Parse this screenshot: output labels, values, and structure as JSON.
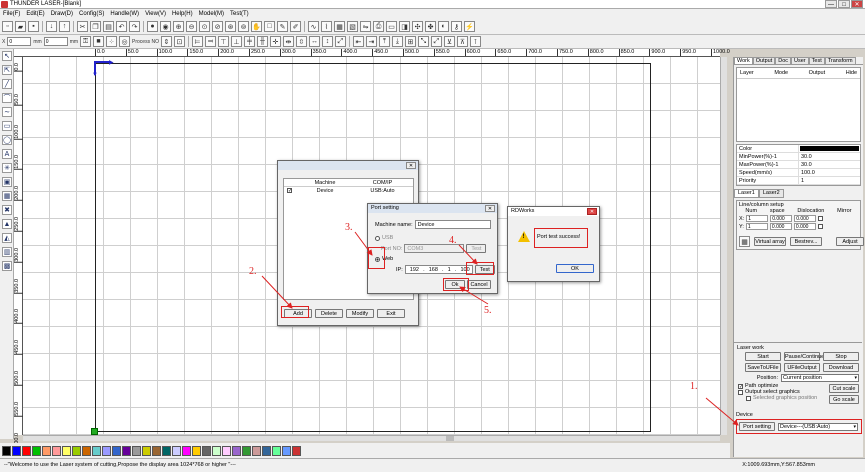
{
  "window": {
    "title": "THUNDER LASER-[Blank]",
    "minimize": "—",
    "maximize": "□",
    "close": "✕"
  },
  "menu": [
    "File(F)",
    "Edit(E)",
    "Draw(D)",
    "Config(S)",
    "Handle(W)",
    "View(V)",
    "Help(H)",
    "Model(M)",
    "Test(T)"
  ],
  "toolbar2": {
    "x_unit": "mm",
    "y_unit": "mm",
    "x_val": "0",
    "y_val": "0",
    "process_no": "Process NO"
  },
  "ruler_h": [
    "0.0",
    "50.0",
    "100.0",
    "150.0",
    "200.0",
    "250.0",
    "300.0",
    "350.0",
    "400.0",
    "450.0",
    "500.0",
    "550.0",
    "600.0",
    "650.0",
    "700.0",
    "750.0",
    "800.0",
    "850.0",
    "900.0",
    "950.0",
    "1000.0"
  ],
  "ruler_v": [
    "0.0",
    "50.0",
    "100.0",
    "150.0",
    "200.0",
    "250.0",
    "300.0",
    "350.0",
    "400.0",
    "450.0",
    "500.0",
    "550.0",
    "600.0"
  ],
  "right_panel": {
    "tabs": [
      "Work",
      "Output",
      "Doc",
      "User",
      "Test",
      "Transform"
    ],
    "layer_cols": [
      "Layer",
      "Mode",
      "Output",
      "Hide"
    ],
    "props": [
      {
        "k": "Color",
        "v": ""
      },
      {
        "k": "MinPower(%)-1",
        "v": "30.0"
      },
      {
        "k": "MaxPower(%)-1",
        "v": "30.0"
      },
      {
        "k": "Speed(mm/s)",
        "v": "100.0"
      },
      {
        "k": "Priority",
        "v": "1"
      }
    ],
    "subtabs": [
      "Laser1",
      "Laser2"
    ],
    "lc_title": "Line/column setup",
    "lc_cols": [
      "Num",
      "space",
      "Dislocation",
      "Mirror"
    ],
    "lc_x": {
      "label": "X:",
      "num": "1",
      "space": "0.000",
      "disloc": "0.000"
    },
    "lc_y": {
      "label": "Y:",
      "num": "1",
      "space": "0.000",
      "disloc": "0.000"
    },
    "lc_buttons": [
      "Virtual array",
      "Bestrev...",
      "Adjust"
    ],
    "lc_selected": "Selected graphics position"
  },
  "laser_work": {
    "title": "Laser work",
    "row1": [
      "Start",
      "Pause/Continue",
      "Stop"
    ],
    "row2": [
      "SaveToUFile",
      "UFileOutput",
      "Download"
    ],
    "position_label": "Position:",
    "position_value": "Current position",
    "path_optimize": "Path optimize",
    "output_select": "Output select graphics",
    "selected_pos": "Selected graphics position",
    "cut_scale": "Cut scale",
    "go_scale": "Go scale",
    "device_label": "Device",
    "port_setting": "Port setting",
    "device_value": "Device---(USB:Auto)"
  },
  "dialog_device": {
    "close": "✕",
    "cols": [
      "Machine",
      "COM/IP"
    ],
    "row": {
      "machine": "Device",
      "port": "USB:Auto"
    },
    "buttons": [
      "Add",
      "Delete",
      "Modify",
      "Exit"
    ]
  },
  "dialog_port": {
    "title": "Port setting",
    "close": "✕",
    "machine_label": "Machine name:",
    "machine_value": "Device",
    "usb_label": "USB",
    "port_no_label": "Port NO:",
    "port_no_value": "COM3",
    "test_disabled": "Test",
    "web_label": "Web",
    "ip_label": "IP:",
    "ip": [
      "192",
      "168",
      "1",
      "100"
    ],
    "test": "Test",
    "ok": "Ok",
    "cancel": "Cancel"
  },
  "dialog_msg": {
    "title": "RDWorks",
    "close": "✕",
    "message": "Port test success!",
    "ok": "OK"
  },
  "annotations": [
    "1.",
    "2.",
    "3.",
    "4.",
    "5."
  ],
  "status": {
    "message": "--\"Welcome to use the Laser system of cutting,Propose the display area 1024*768 or higher \"---",
    "coords": "X:1009.693mm,Y:567.853mm"
  },
  "palette": [
    "#000000",
    "#0000ff",
    "#ff0000",
    "#00c000",
    "#ff9966",
    "#ff9999",
    "#ffff66",
    "#99cc00",
    "#cc6600",
    "#66cccc",
    "#9999ff",
    "#3366cc",
    "#660099",
    "#999999",
    "#cccc00",
    "#996633",
    "#006666",
    "#ccccff",
    "#ff00ff",
    "#ffcc00",
    "#666666",
    "#ccffcc",
    "#ffccff",
    "#9966cc",
    "#339933",
    "#cc9999",
    "#336699",
    "#66ff99",
    "#6699ff",
    "#cc3333"
  ]
}
